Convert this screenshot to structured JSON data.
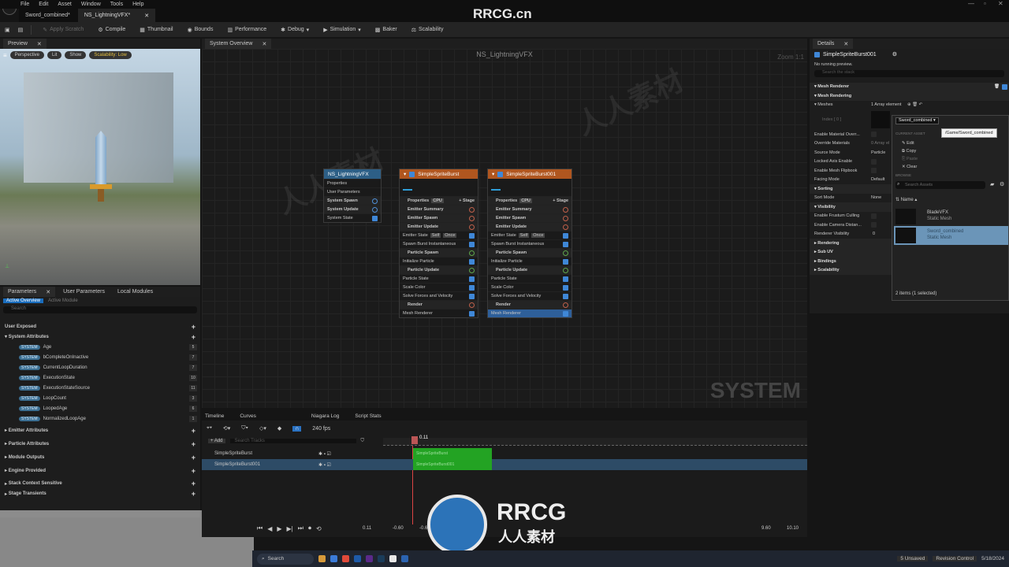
{
  "menu": {
    "items": [
      "File",
      "Edit",
      "Asset",
      "Window",
      "Tools",
      "Help"
    ]
  },
  "tabs": [
    {
      "label": "Sword_combined*"
    },
    {
      "label": "NS_LightningVFX*"
    }
  ],
  "toolbar": {
    "apply_scratch": "Apply Scratch",
    "compile": "Compile",
    "thumbnail": "Thumbnail",
    "bounds": "Bounds",
    "performance": "Performance",
    "debug": "Debug",
    "simulation": "Simulation",
    "baker": "Baker",
    "scalability": "Scalability"
  },
  "watermark": {
    "title": "RRCG.cn",
    "logo_text": "RRCG",
    "logo_sub": "人人素材"
  },
  "preview": {
    "tab": "Preview",
    "perspective": "Perspective",
    "lit": "Lit",
    "show": "Show",
    "scalability": "Scalability: Low"
  },
  "system_overview": {
    "tab": "System Overview",
    "title": "NS_LightningVFX",
    "zoom": "Zoom 1:1",
    "label": "SYSTEM"
  },
  "params": {
    "tabs": [
      "Parameters",
      "User Parameters",
      "Local Modules"
    ],
    "subtabs": [
      "Active Overview",
      "Active Module"
    ],
    "search_placeholder": "Search",
    "sections": {
      "user_exposed": "User Exposed",
      "system_attributes": "System Attributes",
      "emitter_attributes": "Emitter Attributes",
      "particle_attributes": "Particle Attributes",
      "module_outputs": "Module Outputs",
      "engine_provided": "Engine Provided",
      "stack_context": "Stack Context Sensitive",
      "stage_transients": "Stage Transients"
    },
    "system_items": [
      {
        "badge": "SYSTEM",
        "name": "Age",
        "num": "5"
      },
      {
        "badge": "SYSTEM",
        "name": "bCompleteOnInactive",
        "num": "7"
      },
      {
        "badge": "SYSTEM",
        "name": "CurrentLoopDuration",
        "num": "7"
      },
      {
        "badge": "SYSTEM",
        "name": "ExecutionState",
        "num": "10"
      },
      {
        "badge": "SYSTEM",
        "name": "ExecutionStateSource",
        "num": "11"
      },
      {
        "badge": "SYSTEM",
        "name": "LoopCount",
        "num": "3"
      },
      {
        "badge": "SYSTEM",
        "name": "LoopedAge",
        "num": "6"
      },
      {
        "badge": "SYSTEM",
        "name": "NormalizedLoopAge",
        "num": "1"
      }
    ]
  },
  "system_node": {
    "title": "NS_LightningVFX",
    "rows": [
      "Properties",
      "User Parameters",
      "System Spawn",
      "System Update",
      "System State"
    ]
  },
  "emitters": [
    {
      "title": "SimpleSpriteBurst",
      "rows": [
        {
          "label": "Properties",
          "tag": "CPU",
          "right": "+ Stage",
          "kind": "sec"
        },
        {
          "label": "Emitter Summary",
          "kind": "sec"
        },
        {
          "label": "Emitter Spawn",
          "kind": "sec"
        },
        {
          "label": "Emitter Update",
          "kind": "sec"
        },
        {
          "label": "Emitter State",
          "tag": "Self",
          "tag2": "Once",
          "kind": "item"
        },
        {
          "label": "Spawn Burst Instantaneous",
          "kind": "item"
        },
        {
          "label": "Particle Spawn",
          "kind": "sec"
        },
        {
          "label": "Initialize Particle",
          "kind": "item"
        },
        {
          "label": "Particle Update",
          "kind": "sec"
        },
        {
          "label": "Particle State",
          "kind": "item"
        },
        {
          "label": "Scale Color",
          "kind": "item"
        },
        {
          "label": "Solve Forces and Velocity",
          "kind": "item"
        },
        {
          "label": "Render",
          "kind": "sec"
        },
        {
          "label": "Mesh Renderer",
          "kind": "item"
        }
      ]
    },
    {
      "title": "SimpleSpriteBurst001",
      "rows": [
        {
          "label": "Properties",
          "tag": "CPU",
          "right": "+ Stage",
          "kind": "sec"
        },
        {
          "label": "Emitter Summary",
          "kind": "sec"
        },
        {
          "label": "Emitter Spawn",
          "kind": "sec"
        },
        {
          "label": "Emitter Update",
          "kind": "sec"
        },
        {
          "label": "Emitter State",
          "tag": "Self",
          "tag2": "Once",
          "kind": "item"
        },
        {
          "label": "Spawn Burst Instantaneous",
          "kind": "item"
        },
        {
          "label": "Particle Spawn",
          "kind": "sec"
        },
        {
          "label": "Initialize Particle",
          "kind": "item"
        },
        {
          "label": "Particle Update",
          "kind": "sec"
        },
        {
          "label": "Particle State",
          "kind": "item"
        },
        {
          "label": "Scale Color",
          "kind": "item"
        },
        {
          "label": "Solve Forces and Velocity",
          "kind": "item"
        },
        {
          "label": "Render",
          "kind": "sec"
        },
        {
          "label": "Mesh Renderer",
          "kind": "item",
          "selected": true
        }
      ]
    }
  ],
  "details": {
    "tab": "Details",
    "title": "SimpleSpriteBurst001",
    "subtitle": "No running preview.",
    "search_placeholder": "Search the stack",
    "mesh_renderer": "Mesh Renderer",
    "mesh_rendering": "Mesh Rendering",
    "meshes": "Meshes",
    "array": "1 Array element",
    "index": "Index [ 0 ]",
    "props": [
      {
        "label": "Enable Material Overr...",
        "value": ""
      },
      {
        "label": "Override Materials",
        "value": "0 Array el"
      },
      {
        "label": "Source Mode",
        "value": "Particle"
      },
      {
        "label": "Locked Axis Enable",
        "value": ""
      },
      {
        "label": "Enable Mesh Flipbook",
        "value": ""
      },
      {
        "label": "Facing Mode",
        "value": "Default"
      }
    ],
    "sorting": "Sorting",
    "sort_mode": "Sort Mode",
    "sort_value": "None",
    "visibility": "Visibility",
    "vis_props": [
      "Enable Frustum Culling",
      "Enable Camera Distan...",
      "Renderer Visibility"
    ],
    "vis_value": "0",
    "collapsed": [
      "Rendering",
      "Sub UV",
      "Bindings",
      "Scalability"
    ]
  },
  "asset_picker": {
    "selected": "Sword_combined",
    "tooltip": "/Game/Sword_combined",
    "current_asset": "CURRENT ASSET",
    "actions": [
      "Edit",
      "Copy",
      "Paste",
      "Clear"
    ],
    "browse": "BROWSE",
    "search_placeholder": "Search Assets",
    "name_col": "Name",
    "assets": [
      {
        "name": "BladeVFX",
        "type": "Static Mesh"
      },
      {
        "name": "Sword_combined",
        "type": "Static Mesh",
        "selected": true
      }
    ],
    "footer": "2 items (1 selected)"
  },
  "timeline": {
    "tabs": [
      "Timeline",
      "Curves",
      "Niagara Log",
      "Script Stats"
    ],
    "fps": "240 fps",
    "add": "+ Add",
    "search_placeholder": "Search Tracks",
    "playhead": "0.11",
    "tracks": [
      {
        "name": "SimpleSpriteBurst",
        "bar": "SimpleSpriteBurst"
      },
      {
        "name": "SimpleSpriteBurst001",
        "bar": "SimpleSpriteBurst001"
      }
    ],
    "time_current": "0.11",
    "start": "-0.60",
    "start2": "-0.60",
    "end1": "9.60",
    "end2": "10.10"
  },
  "taskbar": {
    "search": "Search",
    "unsaved": "5 Unsaved",
    "revision": "Revision Control",
    "date": "5/18/2024"
  }
}
